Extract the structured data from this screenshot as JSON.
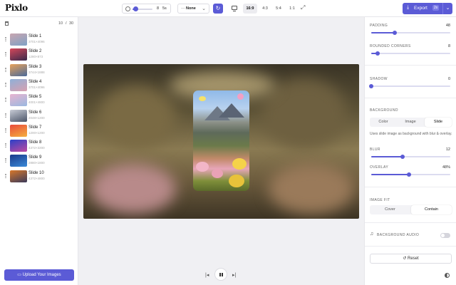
{
  "app": {
    "name": "Pixlo"
  },
  "toolbar": {
    "speed_value": "8",
    "speed_unit": "5s",
    "speed_fraction": 0.15,
    "transition_prefix": "—",
    "transition_value": "None",
    "aspect_ratios": [
      "16:9",
      "4:3",
      "5:4",
      "1:1"
    ],
    "active_ratio": "16:9",
    "export_label": "Export",
    "export_scale": "2x"
  },
  "left_panel": {
    "count_current": "10",
    "count_sep": "/",
    "count_max": "30",
    "slides": [
      {
        "name": "Slide 1",
        "dims": "3701×4096",
        "thumb": [
          "#c9a6b0",
          "#7fa1c5"
        ]
      },
      {
        "name": "Slide 2",
        "dims": "1280×873",
        "thumb": [
          "#d4475a",
          "#3a2a4c"
        ]
      },
      {
        "name": "Slide 3",
        "dims": "3744×1888",
        "thumb": [
          "#e8a25a",
          "#4a6a9a"
        ]
      },
      {
        "name": "Slide 4",
        "dims": "3701×4096",
        "thumb": [
          "#8fb0d8",
          "#d8a0b0"
        ]
      },
      {
        "name": "Slide 5",
        "dims": "4001×4800",
        "thumb": [
          "#e8b4d0",
          "#9ab8e0"
        ]
      },
      {
        "name": "Slide 6",
        "dims": "2048×1200",
        "thumb": [
          "#c8ccd6",
          "#4a5468"
        ]
      },
      {
        "name": "Slide 7",
        "dims": "1200×1200",
        "thumb": [
          "#e84a3a",
          "#f5b040"
        ]
      },
      {
        "name": "Slide 8",
        "dims": "4372×3200",
        "thumb": [
          "#2a40c8",
          "#c04aa0"
        ]
      },
      {
        "name": "Slide 9",
        "dims": "2880×1800",
        "thumb": [
          "#1a3a8a",
          "#3a8ad8"
        ]
      },
      {
        "name": "Slide 10",
        "dims": "4372×4800",
        "thumb": [
          "#d8782a",
          "#3a3a5a"
        ]
      }
    ],
    "upload_label": "Upload Your Images"
  },
  "right_panel": {
    "padding": {
      "label": "PADDING",
      "value": "48",
      "fraction": 0.3
    },
    "rounded": {
      "label": "ROUNDED CORNERS",
      "value": "8",
      "fraction": 0.08
    },
    "shadow": {
      "label": "SHADOW",
      "value": "0",
      "fraction": 0.0
    },
    "background": {
      "label": "BACKGROUND",
      "options": [
        "Color",
        "Image",
        "Slide"
      ],
      "active": "Slide",
      "description": "Uses slide image as background with blur & overlay."
    },
    "blur": {
      "label": "BLUR",
      "value": "12",
      "fraction": 0.4
    },
    "overlay": {
      "label": "OVERLAY",
      "value": "48%",
      "fraction": 0.48
    },
    "image_fit": {
      "label": "IMAGE FIT",
      "options": [
        "Cover",
        "Contain"
      ],
      "active": "Contain"
    },
    "audio": {
      "label": "BACKGROUND AUDIO",
      "enabled": false
    },
    "reset_label": "Reset"
  },
  "colors": {
    "accent": "#5b5bd6",
    "panel": "#ffffff",
    "canvas_bg": "#f0f0f3"
  }
}
